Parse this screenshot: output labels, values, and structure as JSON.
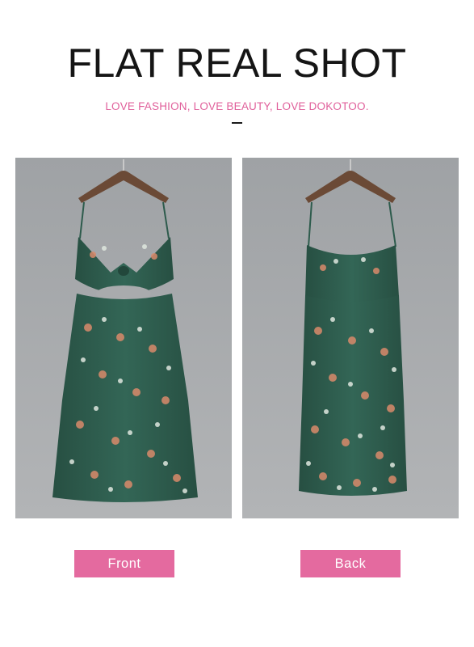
{
  "header": {
    "title": "FLAT REAL SHOT",
    "tagline": "LOVE FASHION, LOVE BEAUTY, LOVE DOKOTOO."
  },
  "photos": {
    "front_label": "Front",
    "back_label": "Back"
  },
  "colors": {
    "tagline": "#e0609b",
    "label_background": "#e46a9f",
    "photo_background": "#a7a9ab",
    "dress": "#2d5b4c",
    "hanger": "#6b4a36"
  }
}
